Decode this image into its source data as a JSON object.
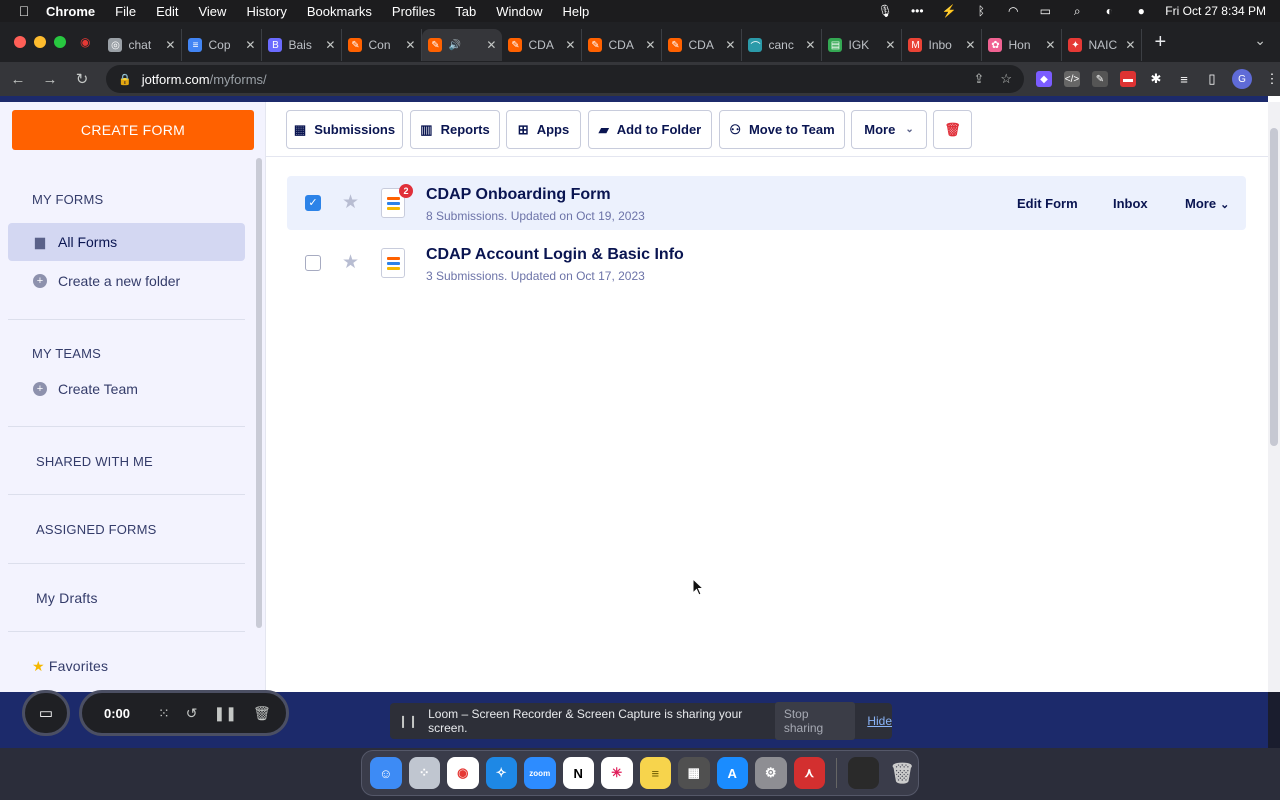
{
  "menubar": {
    "app": "Chrome",
    "items": [
      "File",
      "Edit",
      "View",
      "History",
      "Bookmarks",
      "Profiles",
      "Tab",
      "Window",
      "Help"
    ],
    "clock": "Fri Oct 27  8:34 PM"
  },
  "tabs": [
    {
      "title": "chat",
      "fav": "#9aa0a6",
      "glyph": "◎"
    },
    {
      "title": "Cop",
      "fav": "#4285f4",
      "glyph": "≡"
    },
    {
      "title": "Bais",
      "fav": "#6b6bff",
      "glyph": "B"
    },
    {
      "title": "Con",
      "fav": "#ff6100",
      "glyph": "✎"
    },
    {
      "title": "",
      "fav": "#ff6100",
      "glyph": "✎",
      "active": true
    },
    {
      "title": "CDA",
      "fav": "#ff6100",
      "glyph": "✎"
    },
    {
      "title": "CDA",
      "fav": "#ff6100",
      "glyph": "✎"
    },
    {
      "title": "CDA",
      "fav": "#ff6100",
      "glyph": "✎"
    },
    {
      "title": "canc",
      "fav": "#2b9aa9",
      "glyph": "⌒"
    },
    {
      "title": "IGK",
      "fav": "#34a853",
      "glyph": "▤"
    },
    {
      "title": "Inbo",
      "fav": "#ea4335",
      "glyph": "M"
    },
    {
      "title": "Hon",
      "fav": "#f06292",
      "glyph": "✿"
    },
    {
      "title": "NAIC",
      "fav": "#e53935",
      "glyph": "✦"
    }
  ],
  "omnibox": {
    "domain": "jotform.com",
    "path": "/myforms/"
  },
  "sidebar": {
    "create_label": "CREATE FORM",
    "my_forms": "MY FORMS",
    "all_forms": "All Forms",
    "create_folder": "Create a new folder",
    "my_teams": "MY TEAMS",
    "create_team": "Create Team",
    "shared": "SHARED WITH ME",
    "assigned": "ASSIGNED FORMS",
    "drafts": "My Drafts",
    "favorites": "Favorites"
  },
  "actions": {
    "submissions": "Submissions",
    "reports": "Reports",
    "apps": "Apps",
    "add_folder": "Add to Folder",
    "move_team": "Move to Team",
    "more": "More"
  },
  "forms": [
    {
      "title": "CDAP Onboarding Form",
      "meta": "8 Submissions. Updated on Oct 19, 2023",
      "badge": "2",
      "selected": true,
      "edit": "Edit Form",
      "inbox": "Inbox",
      "more": "More"
    },
    {
      "title": "CDAP Account Login & Basic Info",
      "meta": "3 Submissions. Updated on Oct 17, 2023",
      "badge": "",
      "selected": false
    }
  ],
  "recorder": {
    "timer": "0:00"
  },
  "loom": {
    "message": "Loom – Screen Recorder & Screen Capture is sharing your screen.",
    "stop": "Stop sharing",
    "hide": "Hide"
  },
  "colors": {
    "accent": "#ff6100",
    "navy": "#0a1551",
    "selected": "#ecf1fd",
    "check": "#2c83e8"
  }
}
